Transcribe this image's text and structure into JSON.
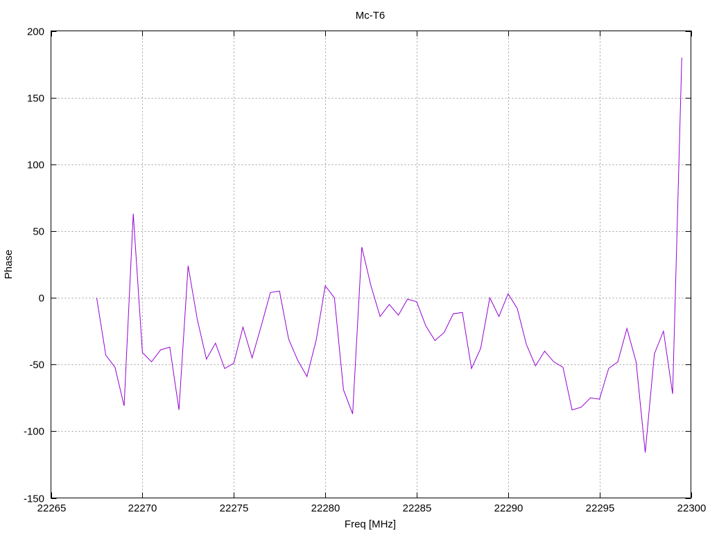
{
  "chart_data": {
    "type": "line",
    "title": "Mc-T6",
    "xlabel": "Freq [MHz]",
    "ylabel": "Phase",
    "xlim": [
      22265,
      22300
    ],
    "ylim": [
      -150,
      200
    ],
    "xticks": [
      22265,
      22270,
      22275,
      22280,
      22285,
      22290,
      22295,
      22300
    ],
    "yticks": [
      -150,
      -100,
      -50,
      0,
      50,
      100,
      150,
      200
    ],
    "grid": true,
    "series": [
      {
        "color": "#9400d3",
        "x": [
          22267.5,
          22268,
          22268.5,
          22269,
          22269.5,
          22270,
          22270.5,
          22271,
          22271.5,
          22272,
          22272.5,
          22273,
          22273.5,
          22274,
          22274.5,
          22275,
          22275.5,
          22276,
          22276.5,
          22277,
          22277.5,
          22278,
          22278.5,
          22279,
          22279.5,
          22280,
          22280.5,
          22281,
          22281.5,
          22282,
          22282.5,
          22283,
          22283.5,
          22284,
          22284.5,
          22285,
          22285.5,
          22286,
          22286.5,
          22287,
          22287.5,
          22288,
          22288.5,
          22289,
          22289.5,
          22290,
          22290.5,
          22291,
          22291.5,
          22292,
          22292.5,
          22293,
          22293.5,
          22294,
          22294.5,
          22295,
          22295.5,
          22296,
          22296.5,
          22297,
          22297.5,
          22298,
          22298.5,
          22299,
          22299.5
        ],
        "y": [
          0,
          -43,
          -52,
          -81,
          63,
          -41,
          -48,
          -39,
          -37,
          -84,
          24,
          -16,
          -46,
          -34,
          -53,
          -49,
          -22,
          -45,
          -21,
          4,
          5,
          -31,
          -47,
          -59,
          -32,
          9,
          0,
          -69,
          -87,
          38,
          9,
          -14,
          -5,
          -13,
          -1,
          -3,
          -21,
          -32,
          -26,
          -12,
          -11,
          -53,
          -38,
          0,
          -14,
          3,
          -8,
          -35,
          -51,
          -40,
          -48,
          -52,
          -84,
          -82,
          -75,
          -76,
          -53,
          -48,
          -23,
          -48,
          -116,
          -42,
          -25,
          -72,
          180
        ]
      }
    ]
  }
}
